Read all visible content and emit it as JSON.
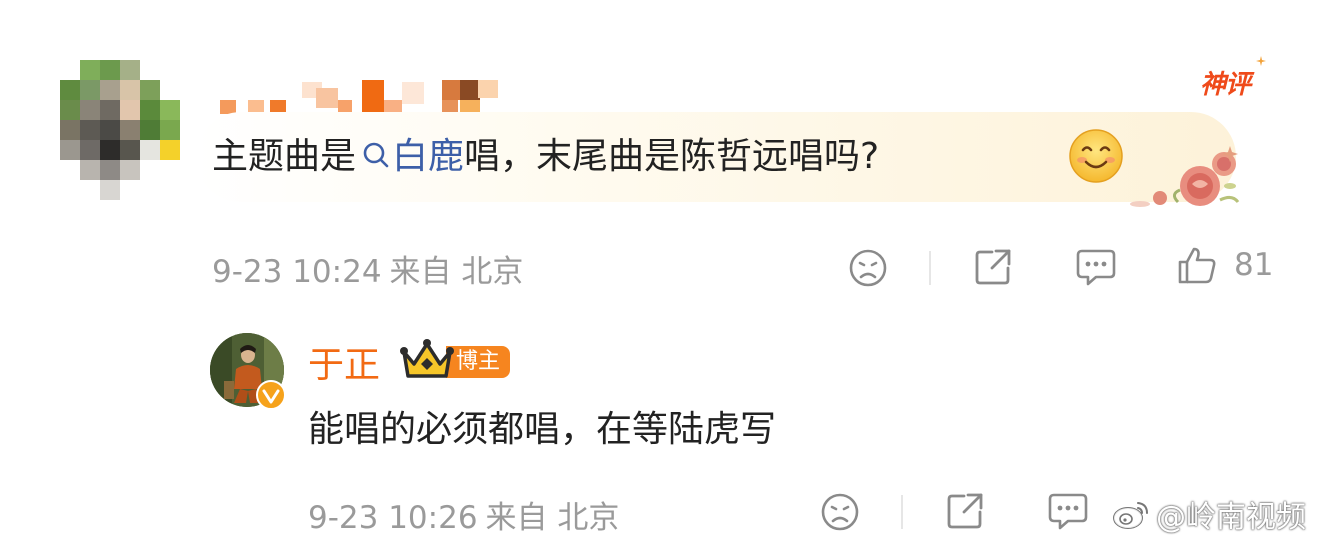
{
  "comment": {
    "text_before_topic": "主题曲是",
    "topic": "白鹿",
    "text_after_topic": "唱，末尾曲是陈哲远唱吗?",
    "badge": "神评",
    "date": "9-23 10:24",
    "source": "来自 北京",
    "likes": "81",
    "icons": [
      "dislike-face-icon",
      "share-icon",
      "comment-icon",
      "thumbs-up-icon",
      "smile-emoji-icon",
      "search-icon"
    ]
  },
  "reply": {
    "author": "于正",
    "author_tag": "博主",
    "text": "能唱的必须都唱，在等陆虎写",
    "date": "9-23 10:26",
    "source": "来自 北京",
    "icons": [
      "dislike-face-icon",
      "share-icon",
      "comment-icon",
      "verified-badge-icon",
      "crown-icon"
    ]
  },
  "watermark": {
    "text": "@岭南视频",
    "icon": "weibo-logo-icon"
  },
  "colors": {
    "topic_link": "#3d5fa8",
    "author_name": "#f26a13",
    "tag_bg": "#f6851f",
    "badge_text": "#ef4a1a",
    "meta_text": "#9a9a9a"
  }
}
